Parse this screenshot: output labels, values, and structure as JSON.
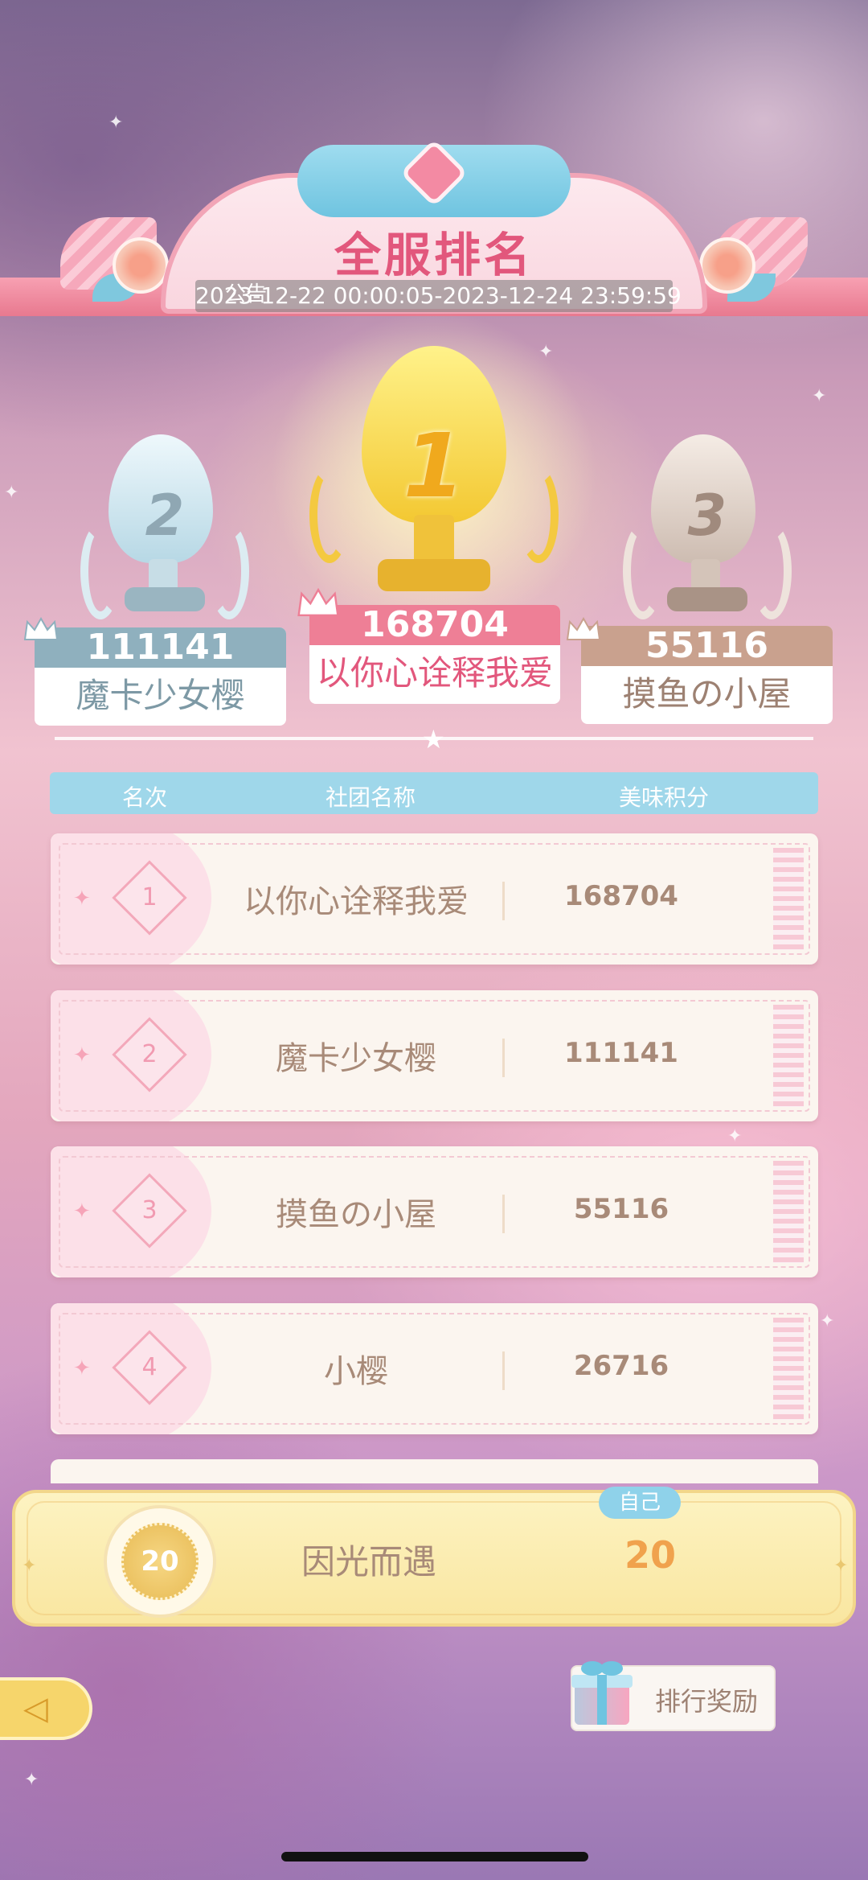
{
  "header": {
    "title": "全服排名",
    "notice_label": "公告",
    "period": "2023-12-22 00:00:05-2023-12-24 23:59:59"
  },
  "podium": {
    "first": {
      "rank": "1",
      "score": "168704",
      "name": "以你心诠释我爱"
    },
    "second": {
      "rank": "2",
      "score": "111141",
      "name": "魔卡少女樱"
    },
    "third": {
      "rank": "3",
      "score": "55116",
      "name": "摸鱼の小屋"
    }
  },
  "table": {
    "headers": {
      "rank": "名次",
      "club": "社团名称",
      "score": "美味积分"
    },
    "rows": [
      {
        "rank": "1",
        "name": "以你心诠释我爱",
        "score": "168704"
      },
      {
        "rank": "2",
        "name": "魔卡少女樱",
        "score": "111141"
      },
      {
        "rank": "3",
        "name": "摸鱼の小屋",
        "score": "55116"
      },
      {
        "rank": "4",
        "name": "小樱",
        "score": "26716"
      }
    ]
  },
  "self": {
    "tag": "自己",
    "rank": "20",
    "name": "因光而遇",
    "score": "20"
  },
  "buttons": {
    "reward_label": "排行奖励",
    "back_icon": "back-arrow-icon"
  },
  "colors": {
    "accent_pink": "#e2577c",
    "header_blue": "#9fd7ea",
    "gold": "#f0a24d"
  }
}
